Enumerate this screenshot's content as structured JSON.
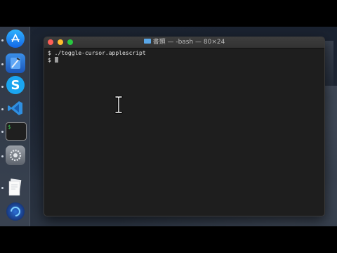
{
  "dock": {
    "items": [
      {
        "name": "app-store",
        "icon": "app-store-icon",
        "running": true
      },
      {
        "name": "xcode",
        "icon": "xcode-icon",
        "running": true
      },
      {
        "name": "skype",
        "icon": "skype-icon",
        "label": "S",
        "running": true
      },
      {
        "name": "vscode",
        "icon": "vscode-icon",
        "running": true
      },
      {
        "name": "terminal",
        "icon": "terminal-icon",
        "label": "$ ",
        "running": true
      },
      {
        "name": "system-preferences",
        "icon": "gear-icon",
        "running": true
      },
      {
        "name": "preview",
        "icon": "preview-icon",
        "running": true
      },
      {
        "name": "mail",
        "icon": "mail-icon",
        "running": false
      }
    ]
  },
  "window": {
    "title": "書類 — -bash — 80×24",
    "lines": [
      "$ ./toggle-cursor.applescript",
      "$ "
    ]
  },
  "colors": {
    "close": "#fe5f57",
    "minimize": "#febc2e",
    "maximize": "#28c840",
    "terminal_bg": "#1e1e1e",
    "terminal_text": "#e6e6e6"
  }
}
